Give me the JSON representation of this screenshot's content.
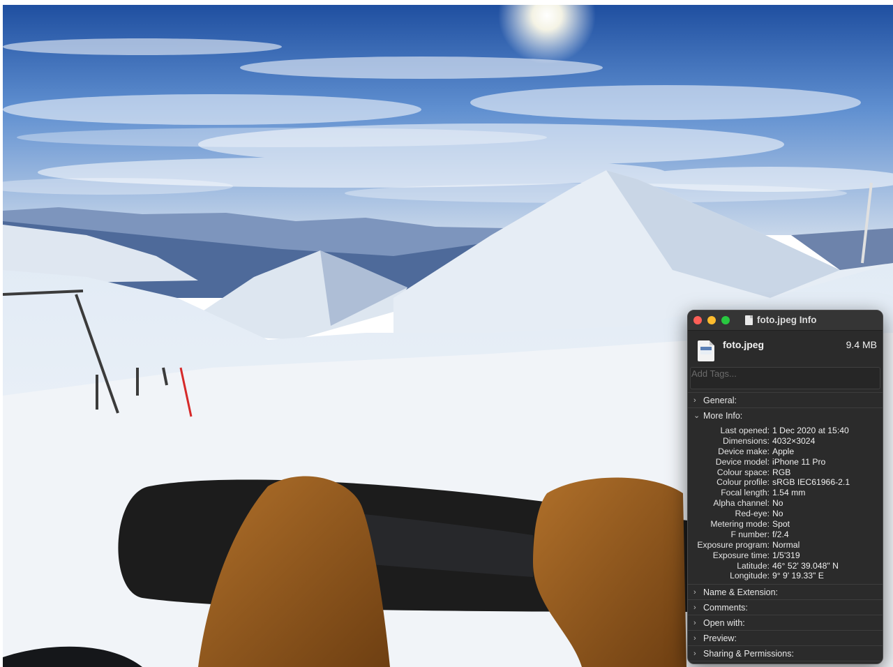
{
  "window": {
    "title": "foto.jpeg Info",
    "file_name": "foto.jpeg",
    "file_size": "9.4 MB",
    "tags_placeholder": "Add Tags..."
  },
  "sections": {
    "general": "General:",
    "more_info": "More Info:",
    "name_extension": "Name & Extension:",
    "comments": "Comments:",
    "open_with": "Open with:",
    "preview": "Preview:",
    "sharing": "Sharing & Permissions:"
  },
  "more_info": [
    {
      "key": "Last opened:",
      "value": "1 Dec 2020 at 15:40"
    },
    {
      "key": "Dimensions:",
      "value": "4032×3024"
    },
    {
      "key": "Device make:",
      "value": "Apple"
    },
    {
      "key": "Device model:",
      "value": "iPhone 11 Pro"
    },
    {
      "key": "Colour space:",
      "value": "RGB"
    },
    {
      "key": "Colour profile:",
      "value": "sRGB IEC61966-2.1"
    },
    {
      "key": "Focal length:",
      "value": "1.54 mm"
    },
    {
      "key": "Alpha channel:",
      "value": "No"
    },
    {
      "key": "Red-eye:",
      "value": "No"
    },
    {
      "key": "Metering mode:",
      "value": "Spot"
    },
    {
      "key": "F number:",
      "value": "f/2.4"
    },
    {
      "key": "Exposure program:",
      "value": "Normal"
    },
    {
      "key": "Exposure time:",
      "value": "1/5'319"
    },
    {
      "key": "Latitude:",
      "value": "46° 52' 39.048\" N"
    },
    {
      "key": "Longitude:",
      "value": "9° 9' 19.33\" E"
    }
  ],
  "colors": {
    "panel_bg": "#2b2b2b",
    "close": "#ff5f57",
    "minimize": "#febc2e",
    "zoom": "#28c840"
  }
}
